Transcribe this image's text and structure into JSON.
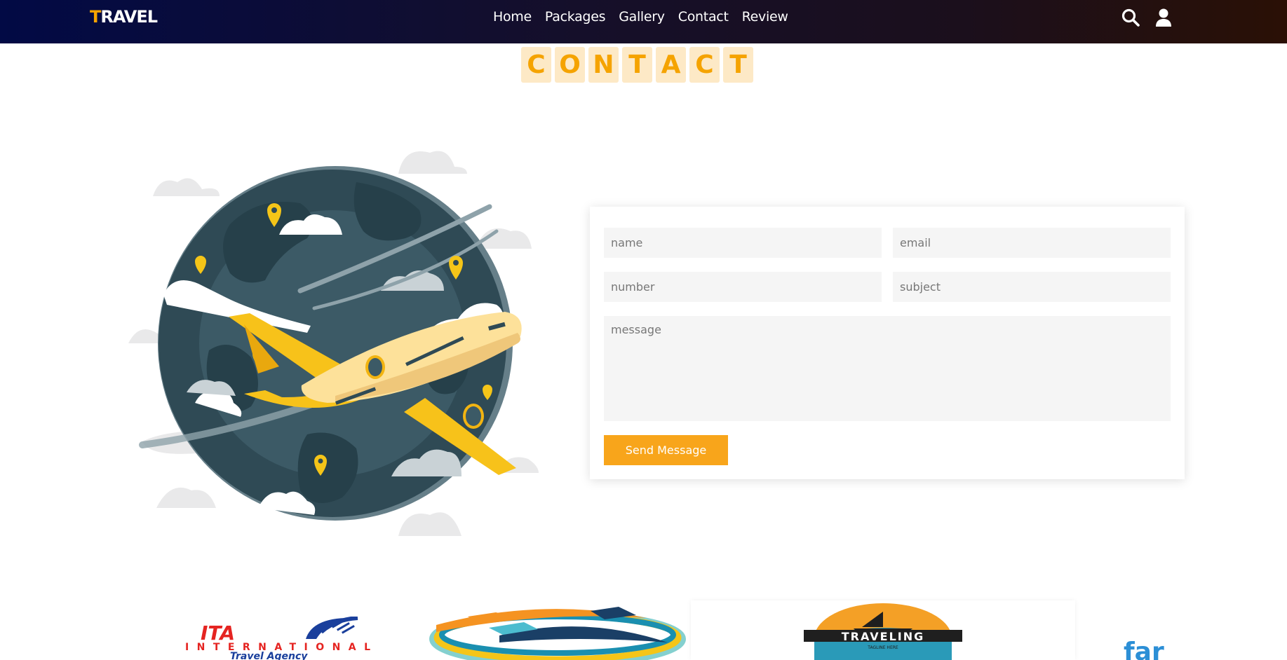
{
  "header": {
    "logo_first": "T",
    "logo_rest": "RAVEL",
    "nav": [
      "Home",
      "Packages",
      "Gallery",
      "Contact",
      "Review"
    ],
    "icons": [
      "search-icon",
      "user-icon"
    ]
  },
  "section": {
    "heading_letters": [
      "C",
      "O",
      "N",
      "T",
      "A",
      "C",
      "T"
    ]
  },
  "form": {
    "name_placeholder": "name",
    "email_placeholder": "email",
    "number_placeholder": "number",
    "subject_placeholder": "subject",
    "message_placeholder": "message",
    "submit_label": "Send Message"
  },
  "partners": {
    "ita_line1": "ITA",
    "ita_line2": "INTERNATIONAL",
    "ita_line3": "Travel Agency",
    "traveling_name": "TRAVELING",
    "traveling_tagline": "TAGLINE HERE",
    "far_text": "far"
  },
  "colors": {
    "accent": "#f5a300",
    "button": "#f8a51b",
    "heading_box": "#fde9c6",
    "header_left": "#020a45",
    "header_right": "#2a1005"
  }
}
